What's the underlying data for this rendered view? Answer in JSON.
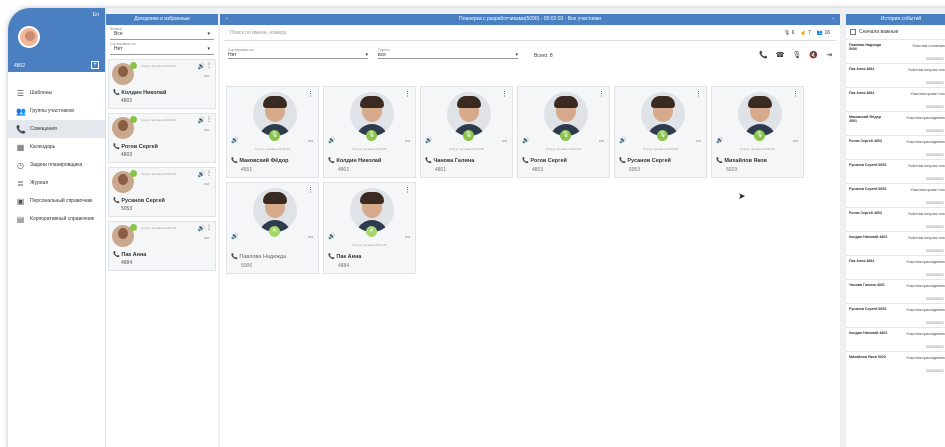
{
  "sidebar": {
    "lang": "En",
    "ext": "4802",
    "add_symbol": "+",
    "items": [
      {
        "label": "Шаблоны",
        "icon": "list-icon"
      },
      {
        "label": "Группы участников",
        "icon": "group-icon"
      },
      {
        "label": "Совещания",
        "icon": "phone-icon"
      },
      {
        "label": "Календарь",
        "icon": "calendar-icon"
      },
      {
        "label": "Задачи планировщика",
        "icon": "clock-icon"
      },
      {
        "label": "Журнал",
        "icon": "journal-icon"
      },
      {
        "label": "Персональный справочник",
        "icon": "contact-card-icon"
      },
      {
        "label": "Корпоративный справочник",
        "icon": "contact-book-icon"
      }
    ]
  },
  "favorites": {
    "title": "Доходчики и избранные",
    "filter_label": "Фильтр",
    "filter_value": "Все",
    "sort_label": "Сортировать по",
    "sort_value": "Нет",
    "cards": [
      {
        "name": "Колдин Николай",
        "ext": "4802",
        "status": "Статус: Активен 00:02:07"
      },
      {
        "name": "Рогов Сергей",
        "ext": "4803",
        "status": "Статус: Активен 00:02:03"
      },
      {
        "name": "Русанов Сергей",
        "ext": "5053",
        "status": "Статус: Активен 00:02:03"
      },
      {
        "name": "Пак Анна",
        "ext": "4884",
        "status": "Статус: Активен 00:01:55"
      }
    ]
  },
  "main": {
    "title": "Планерка с разработчиками(5090) - 00:02:03 · Все участники",
    "search_placeholder": "Поиск по имени, номеру",
    "counts": [
      "6",
      "7",
      "16"
    ],
    "sort_label": "Сортировать по",
    "sort_value": "Нет",
    "group_label": "Группы",
    "group_value": "все",
    "total": "Всего: 8",
    "participants": [
      {
        "name": "Маковский Фёдор",
        "ext": "4551",
        "status": "Статус: Активен 00:00:33",
        "muted": false
      },
      {
        "name": "Колдин Николай",
        "ext": "4802",
        "status": "Статус: Активен 00:02:07",
        "muted": false
      },
      {
        "name": "Чанова Галина",
        "ext": "4801",
        "status": "Статус: Активен 00:01:59",
        "muted": false
      },
      {
        "name": "Рогов Сергей",
        "ext": "4803",
        "status": "Статус: Активен 00:02:03",
        "muted": false
      },
      {
        "name": "Русанов Сергей",
        "ext": "5053",
        "status": "Статус: Активен 00:02:03",
        "muted": false
      },
      {
        "name": "Михайлов Яков",
        "ext": "5029",
        "status": "Статус: Активен 00:02:03",
        "muted": false
      },
      {
        "name": "Павлова Надежда",
        "ext": "5006",
        "status": "",
        "muted": true
      },
      {
        "name": "Пак Анна",
        "ext": "4884",
        "status": "Статус: Активен 00:01:57",
        "muted": true
      }
    ]
  },
  "history": {
    "title": "История событий",
    "important_label": "Сначала важные",
    "rows": [
      {
        "name": "Павлова Надежда 5006",
        "event": "Участник отключился",
        "dt": "2020/05/22 08:04"
      },
      {
        "name": "Пак Анна 4884",
        "event": "Участник получил голос",
        "dt": "2020/05/22 08:04"
      },
      {
        "name": "Пак Анна 4884",
        "event": "Участник просит голос",
        "dt": "2020/05/22 08:04"
      },
      {
        "name": "Маковский Фёдор 4551",
        "event": "Участник присоединился",
        "dt": "2020/05/22 08:03"
      },
      {
        "name": "Рогов Сергей 4803",
        "event": "Участник присоединился",
        "dt": "2020/05/22 08:02"
      },
      {
        "name": "Русанов Сергей 5053",
        "event": "Участник получил голос",
        "dt": "2020/05/22 08:02"
      },
      {
        "name": "Русанов Сергей 5053",
        "event": "Участник просит голос",
        "dt": "2020/05/22 08:02"
      },
      {
        "name": "Рогов Сергей 4803",
        "event": "Участник получил голос",
        "dt": "2020/05/22 08:02"
      },
      {
        "name": "Колдин Николай 4802",
        "event": "Участник получил голос",
        "dt": "2020/05/22 08:02"
      },
      {
        "name": "Пак Анна 4884",
        "event": "Участник присоединился",
        "dt": "2020/05/22 08:02"
      },
      {
        "name": "Чанова Галина 4801",
        "event": "Участник присоединился",
        "dt": "2020/05/22 08:02"
      },
      {
        "name": "Русанов Сергей 5053",
        "event": "Участник присоединился",
        "dt": "2020/05/22 08:02"
      },
      {
        "name": "Колдин Николай 4802",
        "event": "Участник присоединился",
        "dt": "2020/05/22 08:02"
      },
      {
        "name": "Михайлов Яков 5029",
        "event": "Участник присоединился",
        "dt": "2020/05/22 08:02"
      }
    ]
  },
  "colors": {
    "accent": "#4a7fc1",
    "mic": "#8bc34a"
  }
}
